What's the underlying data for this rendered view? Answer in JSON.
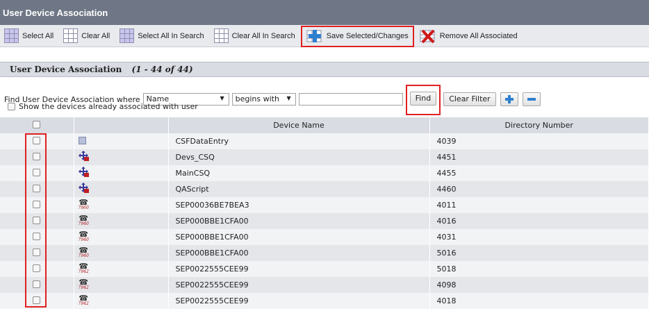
{
  "window": {
    "title": "User Device Association"
  },
  "toolbar": {
    "select_all": "Select All",
    "clear_all": "Clear All",
    "select_all_in_search": "Select All In Search",
    "clear_all_in_search": "Clear All In Search",
    "save_selected": "Save Selected/Changes",
    "remove_all": "Remove All Associated"
  },
  "section": {
    "title": "User Device Association",
    "count": "(1 - 44 of 44)"
  },
  "find": {
    "label": "Find User Device Association where",
    "field": "Name",
    "operator": "begins with",
    "value": "",
    "find_button": "Find",
    "clear_button": "Clear Filter"
  },
  "show_associated": {
    "label": "Show the devices already associated with user"
  },
  "table": {
    "headers": [
      "",
      "",
      "Device Name",
      "Directory Number"
    ],
    "rows": [
      {
        "icon": "csf-icon",
        "model": "",
        "name": "CSFDataEntry",
        "dn": "4039"
      },
      {
        "icon": "ctd-icon",
        "model": "",
        "name": "Devs_CSQ",
        "dn": "4451"
      },
      {
        "icon": "ctd-icon",
        "model": "",
        "name": "MainCSQ",
        "dn": "4455"
      },
      {
        "icon": "ctd-icon",
        "model": "",
        "name": "QAScript",
        "dn": "4460"
      },
      {
        "icon": "phone-icon",
        "model": "7960",
        "name": "SEP00036BE7BEA3",
        "dn": "4011"
      },
      {
        "icon": "phone-icon",
        "model": "7940",
        "name": "SEP000BBE1CFA00",
        "dn": "4016"
      },
      {
        "icon": "phone-icon",
        "model": "7940",
        "name": "SEP000BBE1CFA00",
        "dn": "4031"
      },
      {
        "icon": "phone-icon",
        "model": "7940",
        "name": "SEP000BBE1CFA00",
        "dn": "5016"
      },
      {
        "icon": "phone-icon",
        "model": "7942",
        "name": "SEP0022555CEE99",
        "dn": "5018"
      },
      {
        "icon": "phone-icon",
        "model": "7942",
        "name": "SEP0022555CEE99",
        "dn": "4098"
      },
      {
        "icon": "phone-icon",
        "model": "7942",
        "name": "SEP0022555CEE99",
        "dn": "4018"
      }
    ]
  },
  "colors": {
    "titlebar": "#6f7786",
    "highlight": "#e02020"
  }
}
